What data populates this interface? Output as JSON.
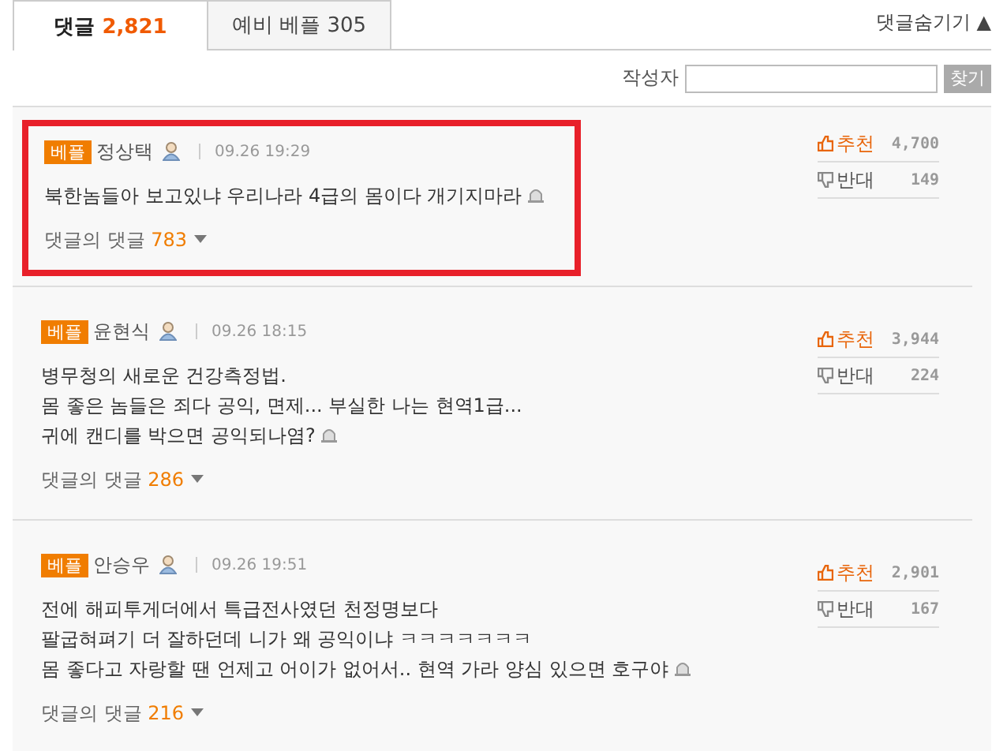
{
  "tabs": [
    {
      "label": "댓글",
      "count": "2,821",
      "selected": true
    },
    {
      "label": "예비 베플",
      "count": "305",
      "selected": false
    }
  ],
  "hide_toggle": {
    "label": "댓글숨기기",
    "arrow": "▲"
  },
  "search": {
    "label": "작성자",
    "button": "찾기"
  },
  "comments": [
    {
      "badge": "베플",
      "author": "정상택",
      "time": "09.26 19:29",
      "highlighted": true,
      "lines": [
        "북한놈들아 보고있냐 우리나라 4급의 몸이다 개기지마라"
      ],
      "replies_label": "댓글의 댓글",
      "replies": "783",
      "up_label": "추천",
      "up": "4,700",
      "down_label": "반대",
      "down": "149"
    },
    {
      "badge": "베플",
      "author": "윤현식",
      "time": "09.26 18:15",
      "highlighted": false,
      "lines": [
        "병무청의 새로운 건강측정법.",
        "몸 좋은 놈들은 죄다 공익, 면제... 부실한 나는 현역1급...",
        "귀에 캔디를 박으면 공익되나염?"
      ],
      "replies_label": "댓글의 댓글",
      "replies": "286",
      "up_label": "추천",
      "up": "3,944",
      "down_label": "반대",
      "down": "224"
    },
    {
      "badge": "베플",
      "author": "안승우",
      "time": "09.26 19:51",
      "highlighted": false,
      "lines": [
        "전에 해피투게더에서 특급전사였던 천정명보다",
        "팔굽혀펴기 더 잘하던데 니가 왜 공익이냐 ㅋㅋㅋㅋㅋㅋㅋ",
        "몸 좋다고 자랑할 땐 언제고 어이가 없어서.. 현역 가라 양심 있으면 호구야"
      ],
      "replies_label": "댓글의 댓글",
      "replies": "216",
      "up_label": "추천",
      "up": "2,901",
      "down_label": "반대",
      "down": "167"
    }
  ]
}
